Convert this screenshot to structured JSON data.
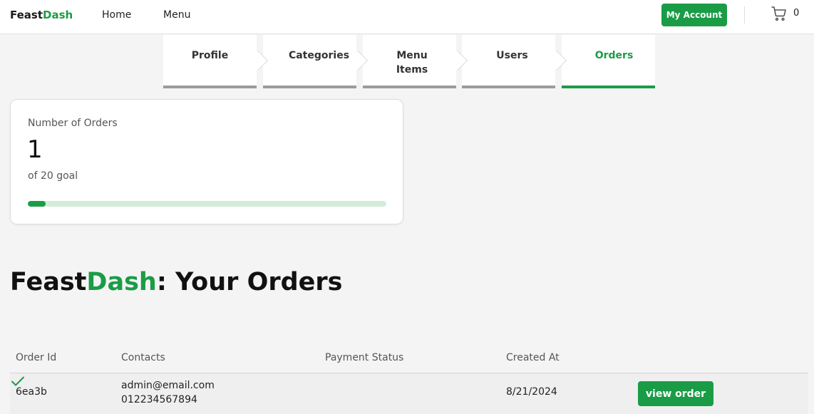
{
  "brand": {
    "part1": "Feast",
    "part2": "Dash"
  },
  "nav": {
    "home": "Home",
    "menu": "Menu"
  },
  "header": {
    "account_label": "My Account",
    "cart_count": "0"
  },
  "tabs": [
    {
      "label": "Profile"
    },
    {
      "label": "Categories"
    },
    {
      "label": "Menu Items"
    },
    {
      "label": "Users"
    },
    {
      "label": "Orders"
    }
  ],
  "stats": {
    "label": "Number of Orders",
    "value": "1",
    "subtitle": "of 20 goal",
    "progress_fraction": 0.05
  },
  "heading": {
    "part1": "Feast",
    "part2": "Dash",
    "part3": ": Your Orders"
  },
  "table": {
    "headers": [
      "Order Id",
      "Contacts",
      "Payment Status",
      "Created At"
    ],
    "rows": [
      {
        "order_id": "6ea3b",
        "email": "admin@email.com",
        "phone": "012234567894",
        "payment_status_icon": "check-icon",
        "created_at": "8/21/2024",
        "action_label": "view order"
      }
    ]
  },
  "colors": {
    "accent": "#1a9c46",
    "tab_inactive": "#9b9b9b",
    "progress_track": "#d3ecd9"
  }
}
